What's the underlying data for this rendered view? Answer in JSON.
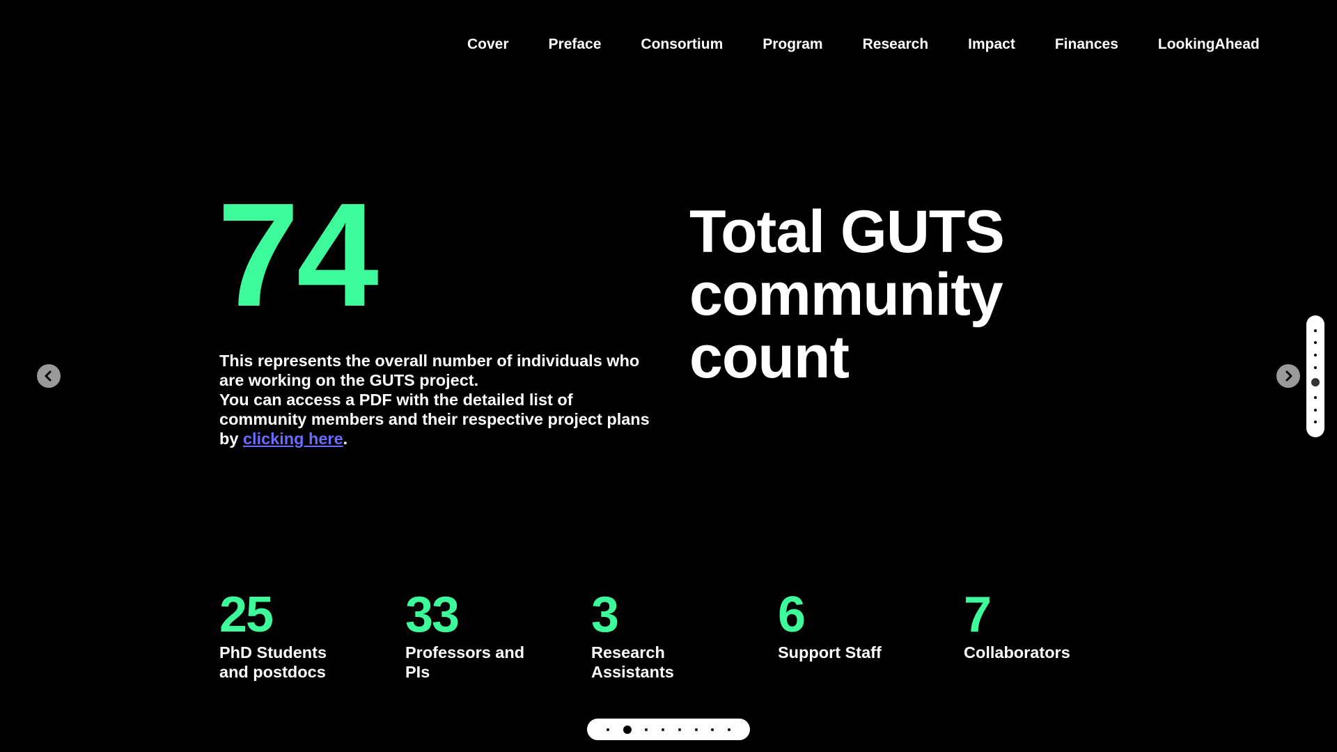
{
  "nav": {
    "items": [
      "Cover",
      "Preface",
      "Consortium",
      "Program",
      "Research",
      "Impact",
      "Finances",
      "LookingAhead"
    ]
  },
  "hero": {
    "number": "74",
    "title_lines": [
      "Total GUTS",
      "community",
      "count"
    ],
    "desc_line1": "This represents the overall number of individuals who are working on the GUTS project.",
    "desc_line2_before": "You can access a PDF with the detailed list of community members and their respective project plans by ",
    "link_text": "clicking here",
    "desc_line2_after": "."
  },
  "stats": [
    {
      "value": "25",
      "label": "PhD Students and postdocs"
    },
    {
      "value": "33",
      "label": "Professors and PIs"
    },
    {
      "value": "3",
      "label": "Research Assistants"
    },
    {
      "value": "6",
      "label": "Support Staff"
    },
    {
      "value": "7",
      "label": "Collaborators"
    }
  ],
  "pagers": {
    "vertical": {
      "count": 8,
      "active_index": 4
    },
    "horizontal": {
      "count": 8,
      "active_index": 1
    }
  },
  "colors": {
    "background": "#000000",
    "accent_green": "#3dfa9b",
    "link": "#6b6bff",
    "text": "#ffffff"
  },
  "icons": {
    "prev": "chevron-left-icon",
    "next": "chevron-right-icon"
  }
}
